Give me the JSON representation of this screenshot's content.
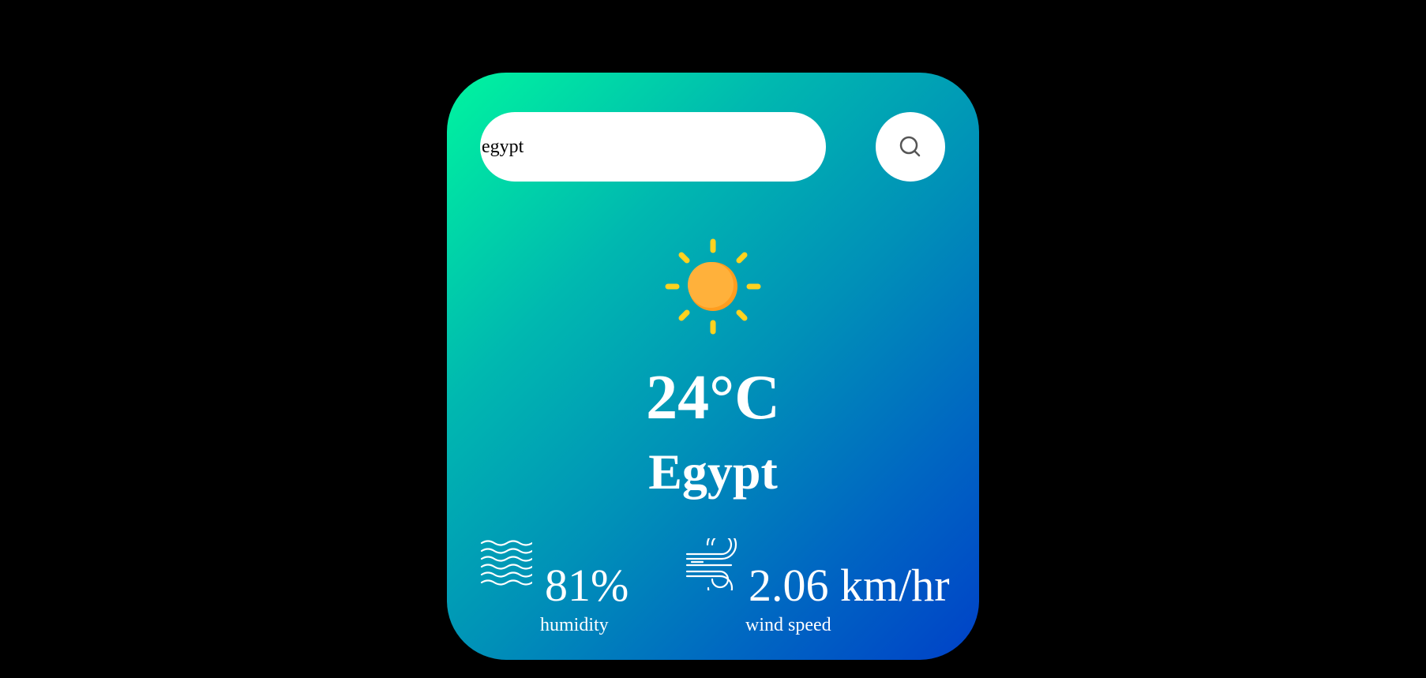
{
  "search": {
    "value": "egypt",
    "placeholder": ""
  },
  "weather": {
    "icon": "sun-icon",
    "temperature": "24°C",
    "city": "Egypt"
  },
  "details": {
    "humidity": {
      "icon": "waves-icon",
      "value": "81%",
      "label": "humidity"
    },
    "wind": {
      "icon": "wind-icon",
      "value": "2.06 km/hr",
      "label": "wind speed"
    }
  },
  "colors": {
    "background": "#000000",
    "card_gradient_start": "#00f59f",
    "card_gradient_end": "#0041c8",
    "sun_core": "#ffb13b",
    "sun_rays": "#ffd21f",
    "text": "#ffffff"
  }
}
